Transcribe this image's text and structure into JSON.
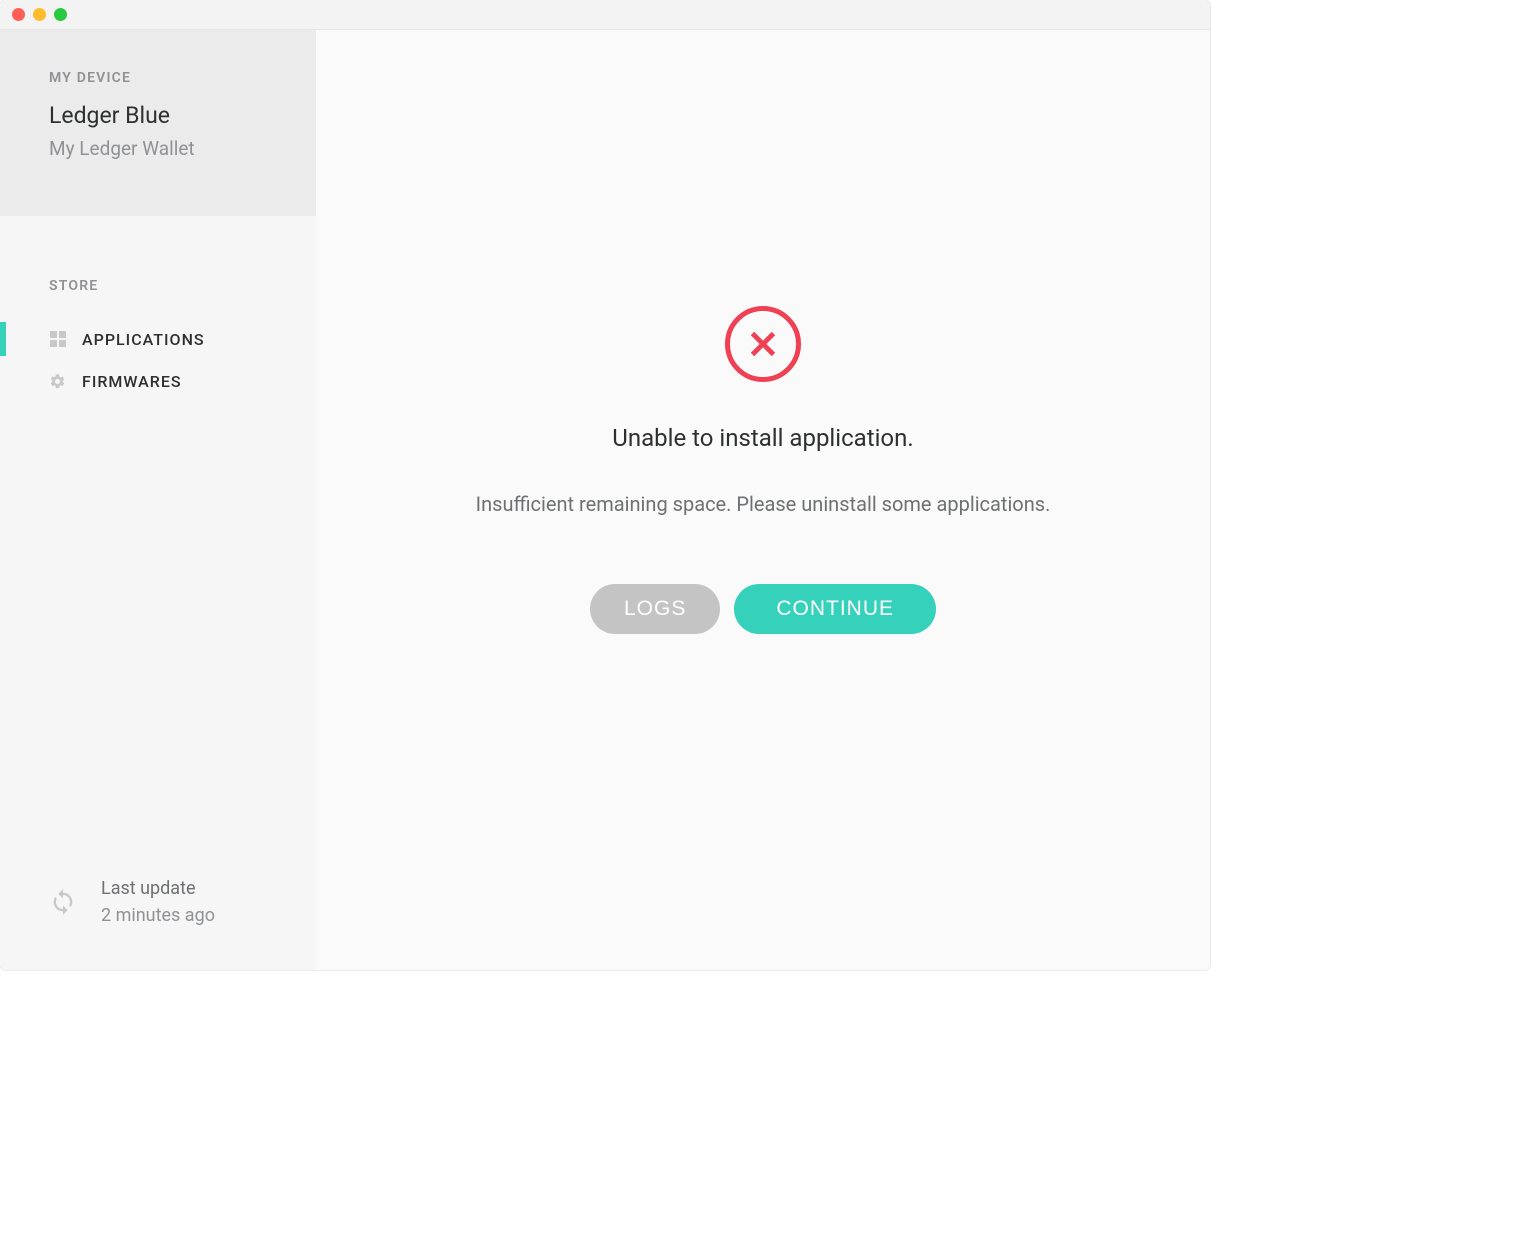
{
  "sidebar": {
    "my_device_heading": "MY DEVICE",
    "device_name": "Ledger Blue",
    "device_subtitle": "My Ledger Wallet",
    "store_heading": "STORE",
    "nav": {
      "applications": "APPLICATIONS",
      "firmwares": "FIRMWARES"
    },
    "footer": {
      "label": "Last update",
      "time": "2 minutes ago"
    }
  },
  "main": {
    "error_title": "Unable to install application.",
    "error_subtitle": "Insufficient remaining space. Please uninstall some applications.",
    "logs_label": "LOGS",
    "continue_label": "CONTINUE"
  },
  "colors": {
    "accent": "#35d1bb",
    "error": "#ef4054"
  }
}
